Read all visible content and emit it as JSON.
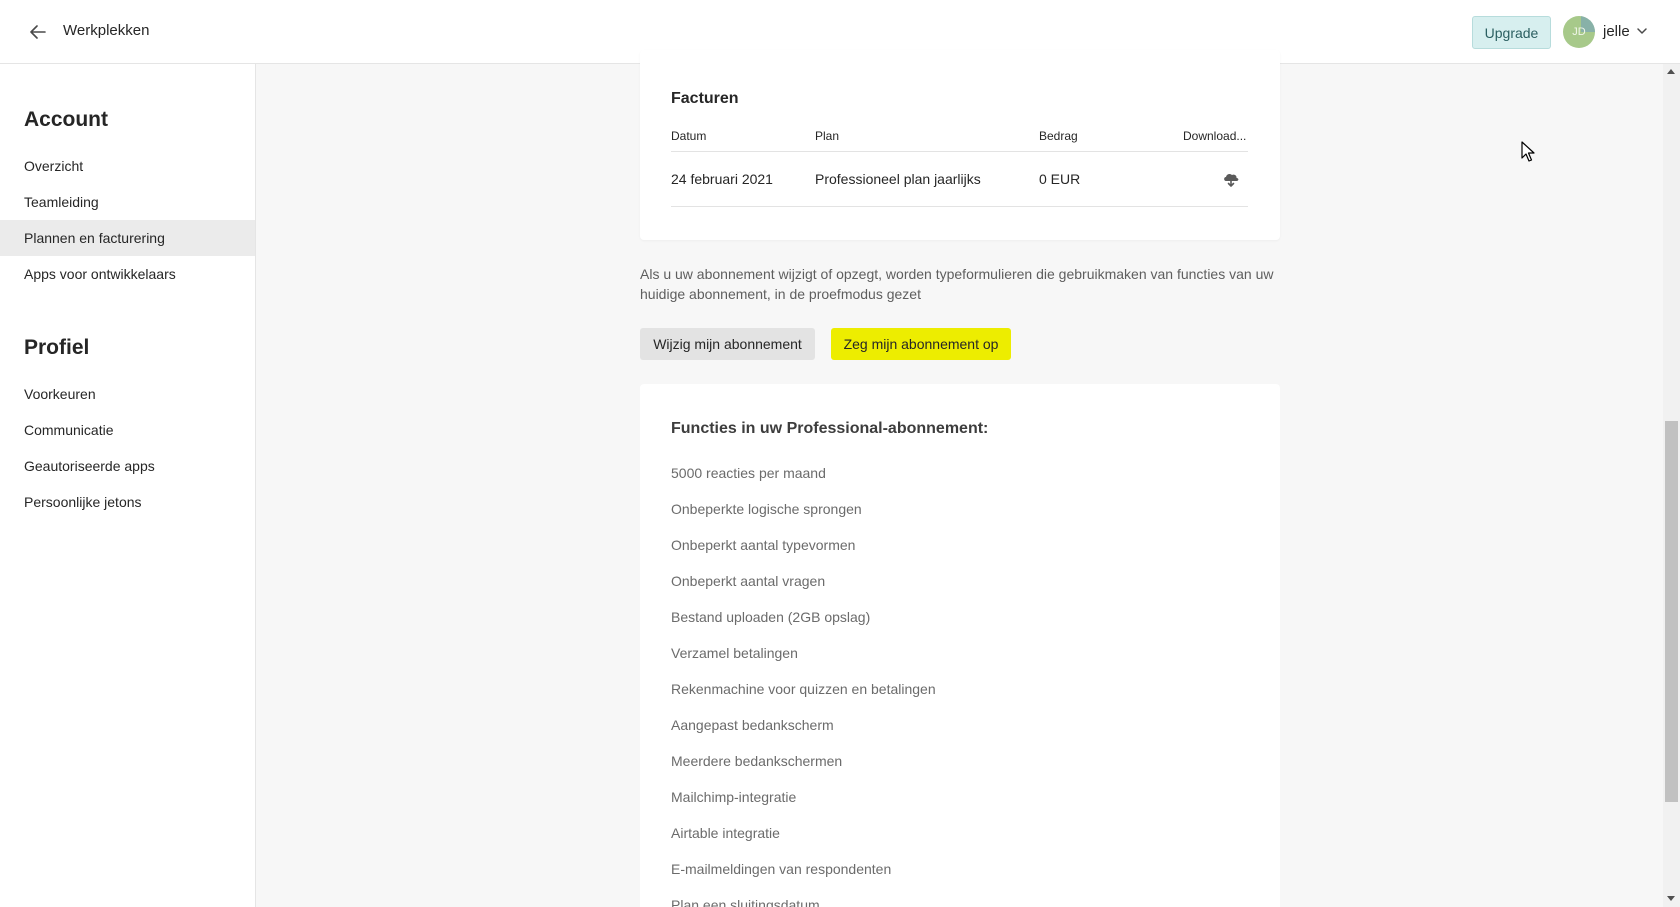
{
  "topbar": {
    "back_label": "Werkplekken",
    "upgrade_label": "Upgrade",
    "avatar_initials": "JD",
    "user_name": "jelle"
  },
  "sidebar": {
    "account_heading": "Account",
    "account_items": [
      {
        "label": "Overzicht",
        "active": false
      },
      {
        "label": "Teamleiding",
        "active": false
      },
      {
        "label": "Plannen en facturering",
        "active": true
      },
      {
        "label": "Apps voor ontwikkelaars",
        "active": false
      }
    ],
    "profile_heading": "Profiel",
    "profile_items": [
      {
        "label": "Voorkeuren"
      },
      {
        "label": "Communicatie"
      },
      {
        "label": "Geautoriseerde apps"
      },
      {
        "label": "Persoonlijke jetons"
      }
    ]
  },
  "invoices": {
    "title": "Facturen",
    "columns": [
      "Datum",
      "Plan",
      "Bedrag",
      "Download..."
    ],
    "rows": [
      {
        "date": "24 februari 2021",
        "plan": "Professioneel plan jaarlijks",
        "amount": "0 EUR",
        "download_icon": "cloud-download-icon"
      }
    ]
  },
  "notice": "Als u uw abonnement wijzigt of opzegt, worden typeformulieren die gebruikmaken van functies van uw huidige abonnement, in de proefmodus gezet",
  "actions": {
    "change_label": "Wijzig mijn abonnement",
    "cancel_label": "Zeg mijn abonnement op"
  },
  "features": {
    "title": "Functies in uw Professional-abonnement:",
    "items": [
      "5000 reacties per maand",
      "Onbeperkte logische sprongen",
      "Onbeperkt aantal typevormen",
      "Onbeperkt aantal vragen",
      "Bestand uploaden (2GB opslag)",
      "Verzamel betalingen",
      "Rekenmachine voor quizzen en betalingen",
      "Aangepast bedankscherm",
      "Meerdere bedankschermen",
      "Mailchimp-integratie",
      "Airtable integratie",
      "E-mailmeldingen van respondenten",
      "Plan een sluitingsdatum"
    ]
  },
  "colors": {
    "cancel_button": "#eded00",
    "upgrade_button": "#d7efef",
    "active_sidebar": "#ebebeb"
  }
}
